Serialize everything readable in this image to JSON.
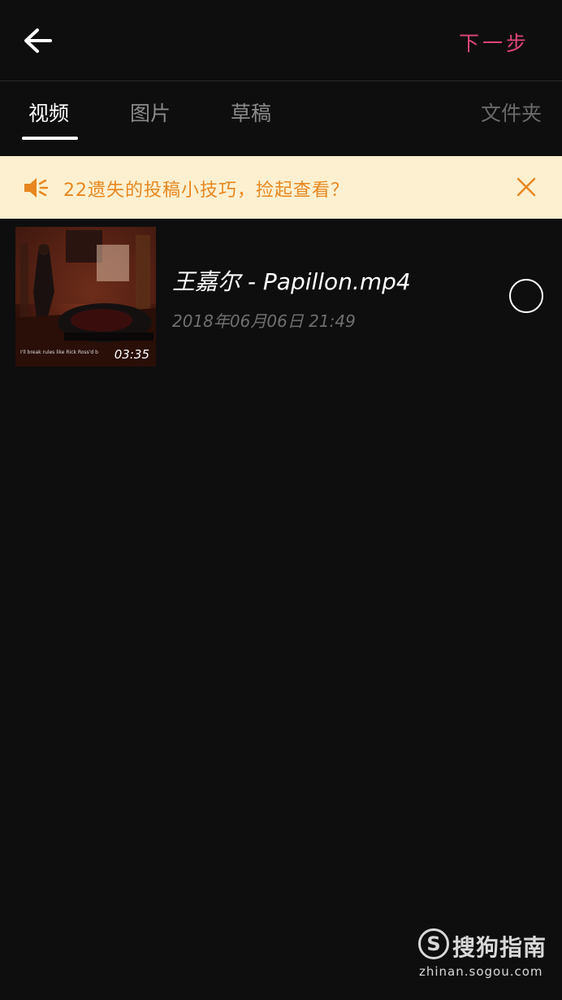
{
  "header": {
    "back_icon": "arrow-left-icon",
    "next_label": "下一步"
  },
  "tabs": [
    {
      "label": "视频",
      "active": true
    },
    {
      "label": "图片",
      "active": false
    },
    {
      "label": "草稿",
      "active": false
    },
    {
      "label": "文件夹",
      "active": false
    }
  ],
  "notice": {
    "icon": "speaker-icon",
    "text": "22遗失的投稿小技巧，捡起查看？",
    "close_icon": "close-icon"
  },
  "videos": [
    {
      "title": "王嘉尔 - Papillon.mp4",
      "date": "2018年06月06日  21:49",
      "duration": "03:35",
      "thumb_caption": "I'll break rules like Rick Ross'd b",
      "selected": false
    }
  ],
  "watermark": {
    "logo_letter": "S",
    "brand": "搜狗指南",
    "url": "zhinan.sogou.com"
  },
  "colors": {
    "background": "#0e0e0e",
    "accent": "#e0457b",
    "notice_bg": "#fdf0d0",
    "notice_text": "#e8871f"
  }
}
